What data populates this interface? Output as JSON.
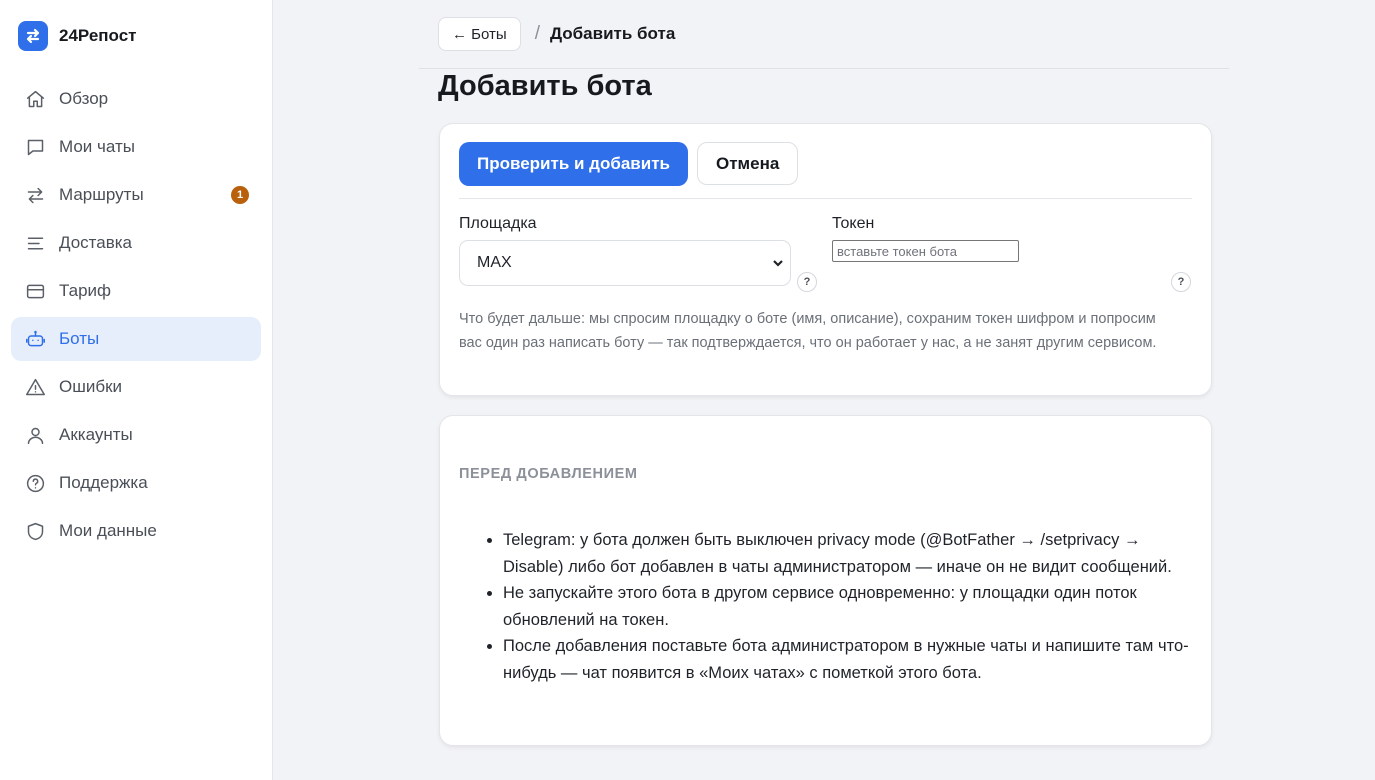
{
  "brand": {
    "name": "24Репост"
  },
  "sidebar": {
    "items": [
      {
        "label": "Обзор",
        "icon": "home-icon"
      },
      {
        "label": "Мои чаты",
        "icon": "chat-icon"
      },
      {
        "label": "Маршруты",
        "icon": "route-arrows-icon",
        "badge": "1"
      },
      {
        "label": "Доставка",
        "icon": "lines-icon"
      },
      {
        "label": "Тариф",
        "icon": "card-icon"
      },
      {
        "label": "Боты",
        "icon": "bot-icon",
        "active": true
      },
      {
        "label": "Ошибки",
        "icon": "warning-icon"
      },
      {
        "label": "Аккаунты",
        "icon": "user-icon"
      },
      {
        "label": "Поддержка",
        "icon": "help-circle-icon"
      },
      {
        "label": "Мои данные",
        "icon": "shield-icon"
      }
    ]
  },
  "breadcrumb": {
    "back_label": "← Боты",
    "separator": "/",
    "current": "Добавить бота"
  },
  "page": {
    "title": "Добавить бота"
  },
  "form": {
    "submit_label": "Проверить и добавить",
    "cancel_label": "Отмена",
    "platform_label": "Площадка",
    "platform_value": "MAX",
    "token_label": "Токен",
    "token_placeholder": "вставьте токен бота",
    "help_mark": "?",
    "hint": "Что будет дальше: мы спросим площадку о боте (имя, описание), сохраним токен шифром и попросим вас один раз написать боту — так подтверждается, что он работает у нас, а не занят другим сервисом."
  },
  "info": {
    "heading": "Перед добавлением",
    "rules": [
      "Telegram: у бота должен быть выключен privacy mode (@BotFather → /setprivacy → Disable) либо бот добавлен в чаты администратором — иначе он не видит сообщений.",
      "Не запускайте этого бота в другом сервисе одновременно: у площадки один поток обновлений на токен.",
      "После добавления поставьте бота администратором в нужные чаты и напишите там что-нибудь — чат появится в «Моих чатах» с пометкой этого бота."
    ]
  },
  "colors": {
    "accent": "#2f6fe9",
    "badge": "#b8600b",
    "active_bg": "#e6eefc"
  }
}
